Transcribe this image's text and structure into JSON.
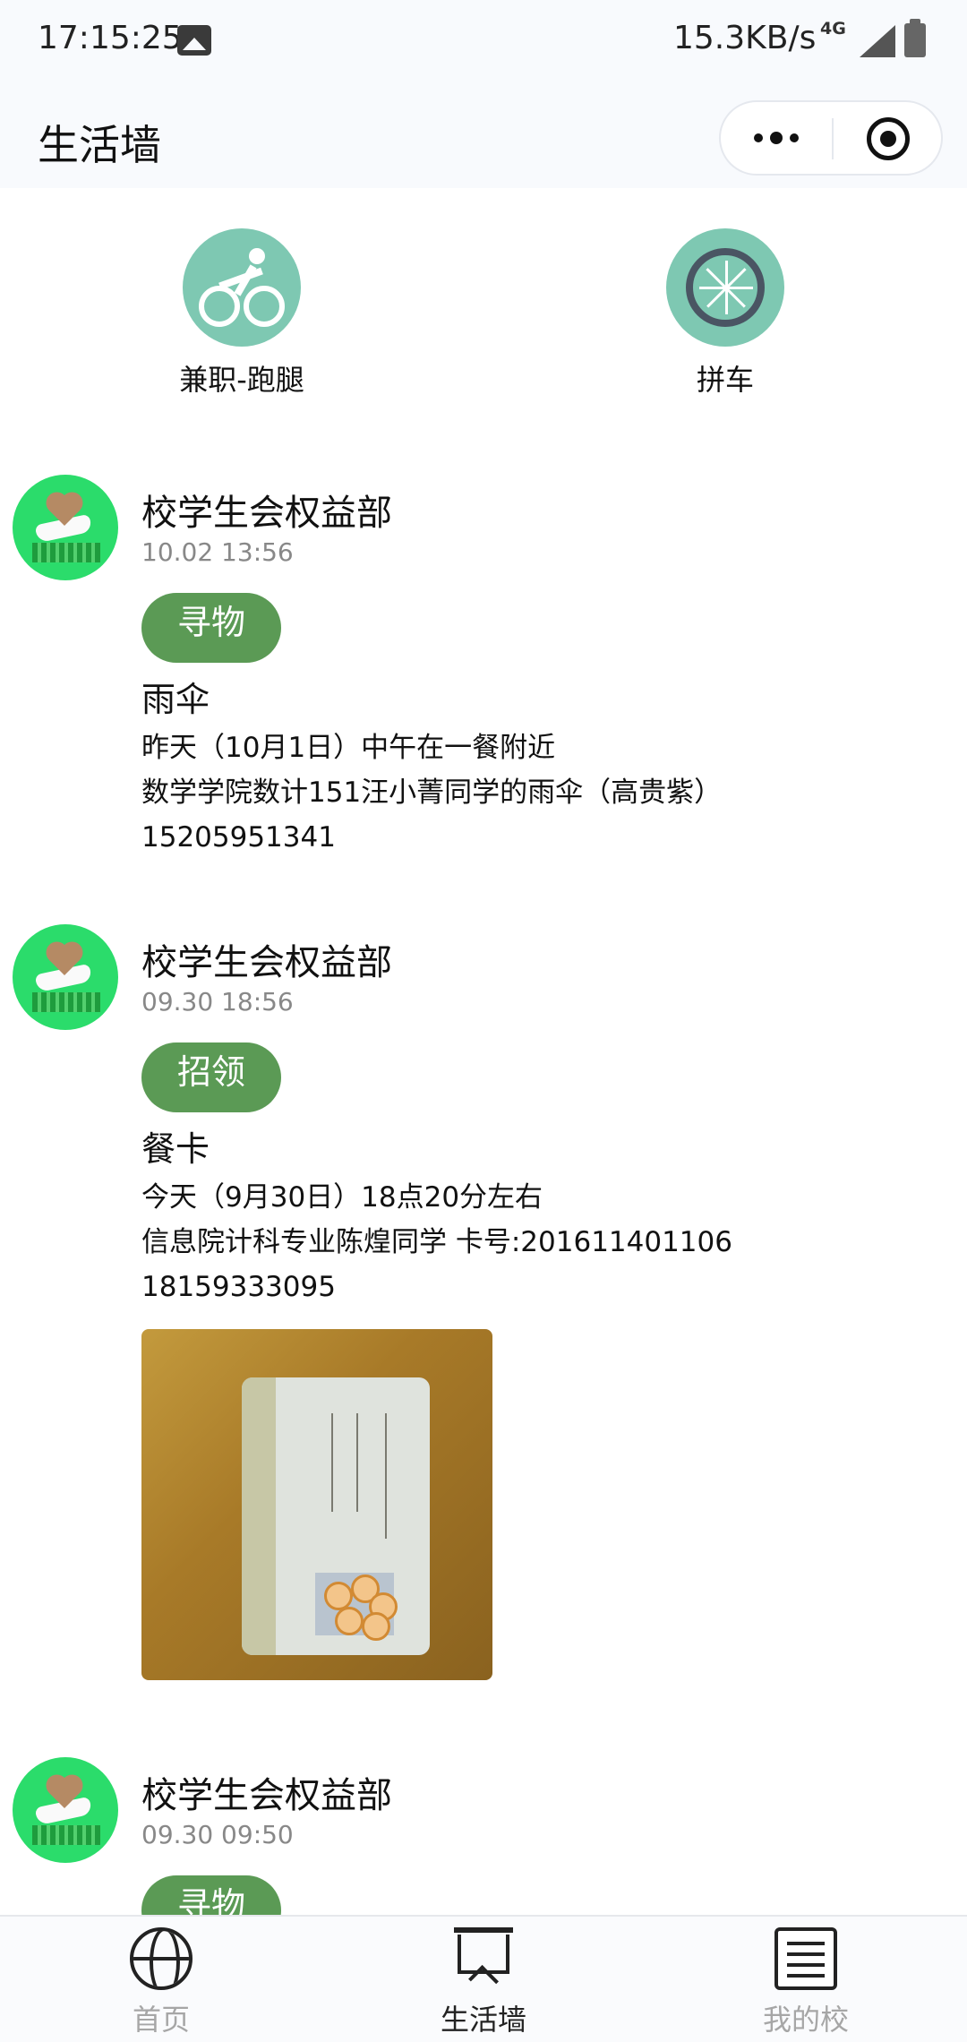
{
  "status_bar": {
    "time": "17:15:25",
    "network_speed": "15.3KB/s",
    "network_type": "4G",
    "icons": [
      "image-icon",
      "signal-icon",
      "battery-icon"
    ]
  },
  "header": {
    "title": "生活墙",
    "more_icon": "more-dots-icon",
    "close_icon": "target-close-icon"
  },
  "quick_entries": [
    {
      "label": "兼职-跑腿",
      "icon": "bicycle-icon",
      "color": "#7ec8b2"
    },
    {
      "label": "拼车",
      "icon": "wheel-icon",
      "color": "#7ec8b2"
    }
  ],
  "posts": [
    {
      "author": "校学生会权益部",
      "time": "10.02 13:56",
      "tag": "寻物",
      "title": "雨伞",
      "body": "昨天（10月1日）中午在一餐附近\n数学学院数计151汪小菁同学的雨伞（高贵紫）\n15205951341"
    },
    {
      "author": "校学生会权益部",
      "time": "09.30 18:56",
      "tag": "招领",
      "title": "餐卡",
      "body": "今天（9月30日）18点20分左右\n信息院计科专业陈煌同学 卡号:201611401106\n18159333095",
      "image_alt": "meal-card-photo"
    },
    {
      "author": "校学生会权益部",
      "time": "09.30 09:50",
      "tag": "寻物"
    }
  ],
  "tab_bar": {
    "items": [
      {
        "label": "首页",
        "icon": "globe-icon",
        "active": false
      },
      {
        "label": "生活墙",
        "icon": "board-icon",
        "active": true
      },
      {
        "label": "我的校",
        "icon": "receipt-icon",
        "active": false
      }
    ]
  },
  "colors": {
    "tag_green": "#5b9a55",
    "avatar_green": "#2bdc6b",
    "entry_teal": "#7ec8b2",
    "muted_text": "#888888"
  }
}
